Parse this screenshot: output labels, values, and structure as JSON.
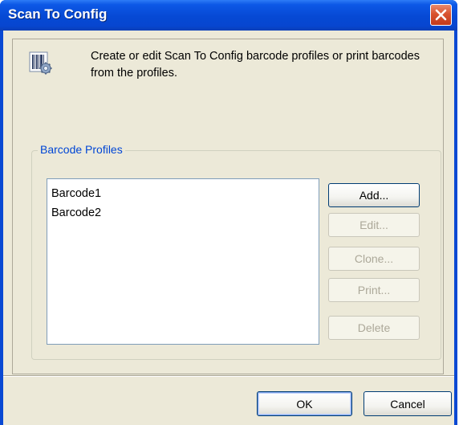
{
  "window": {
    "title": "Scan To Config"
  },
  "titlebar": {
    "close_icon": "close-icon"
  },
  "description": {
    "icon": "barcode-settings-icon",
    "text": "Create or edit Scan To Config barcode profiles or print barcodes from the profiles."
  },
  "profiles": {
    "group_label": "Barcode Profiles",
    "items": [
      "Barcode1",
      "Barcode2"
    ]
  },
  "actions": {
    "add": "Add...",
    "edit": "Edit...",
    "clone": "Clone...",
    "print": "Print...",
    "delete": "Delete"
  },
  "footer": {
    "ok": "OK",
    "cancel": "Cancel"
  }
}
